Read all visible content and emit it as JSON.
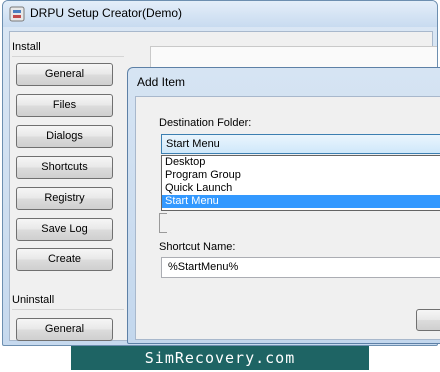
{
  "window": {
    "title": "DRPU Setup Creator(Demo)"
  },
  "sidebar": {
    "install_label": "Install",
    "install_buttons": [
      "General",
      "Files",
      "Dialogs",
      "Shortcuts",
      "Registry",
      "Save Log",
      "Create"
    ],
    "uninstall_label": "Uninstall",
    "uninstall_buttons": [
      "General"
    ]
  },
  "dialog": {
    "title": "Add Item",
    "destination_label": "Destination Folder:",
    "destination_selected": "Start Menu",
    "destination_options": [
      "Desktop",
      "Program Group",
      "Quick Launch",
      "Start Menu"
    ],
    "shortcut_label": "Shortcut Name:",
    "shortcut_value": "%StartMenu%"
  },
  "watermark": {
    "text": "SimRecovery.com"
  },
  "colors": {
    "selection": "#3399ff",
    "watermark_bg": "#1e6464",
    "title_gradient_top": "#e4eef9",
    "title_gradient_bottom": "#c8dbf0"
  }
}
